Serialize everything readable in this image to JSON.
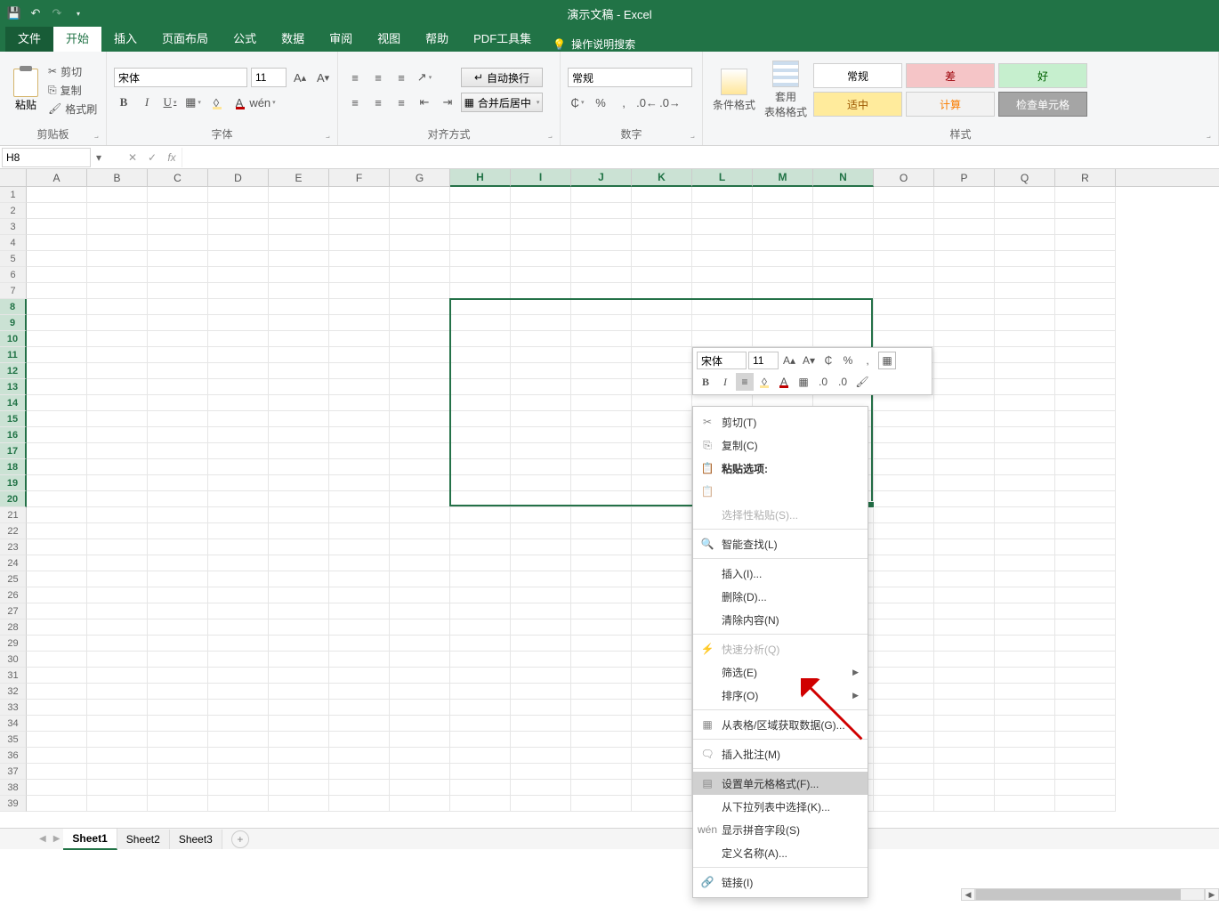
{
  "app": {
    "title": "演示文稿  -  Excel"
  },
  "tabs": {
    "file": "文件",
    "items": [
      "开始",
      "插入",
      "页面布局",
      "公式",
      "数据",
      "审阅",
      "视图",
      "帮助",
      "PDF工具集"
    ],
    "active": "开始",
    "tell": "操作说明搜索"
  },
  "ribbon": {
    "clipboard": {
      "label": "剪贴板",
      "paste": "粘贴",
      "cut": "剪切",
      "copy": "复制",
      "painter": "格式刷"
    },
    "font": {
      "label": "字体",
      "name": "宋体",
      "size": "11",
      "bold": "B",
      "italic": "I",
      "underline": "U"
    },
    "align": {
      "label": "对齐方式",
      "wrap": "自动换行",
      "merge": "合并后居中"
    },
    "number": {
      "label": "数字",
      "format": "常规",
      "percent": "%",
      "comma": ","
    },
    "styles": {
      "label": "样式",
      "cond": "条件格式",
      "table": "套用\n表格格式",
      "normal": "常规",
      "bad": "差",
      "good": "好",
      "neutral": "适中",
      "calc": "计算",
      "check": "检查单元格"
    }
  },
  "fx": {
    "cellref": "H8",
    "x": "✕",
    "chk": "✓",
    "fx": "fx"
  },
  "sheet": {
    "cols": [
      "A",
      "B",
      "C",
      "D",
      "E",
      "F",
      "G",
      "H",
      "I",
      "J",
      "K",
      "L",
      "M",
      "N",
      "O",
      "P",
      "Q",
      "R"
    ],
    "rows": 39,
    "selColsFrom": 7,
    "selColsTo": 13,
    "selRowsFrom": 8,
    "selRowsTo": 20,
    "tabs": [
      "Sheet1",
      "Sheet2",
      "Sheet3"
    ],
    "activeTab": "Sheet1"
  },
  "mini": {
    "font": "宋体",
    "size": "11"
  },
  "ctx": {
    "cut": "剪切(T)",
    "copy": "复制(C)",
    "pasteopt": "粘贴选项:",
    "pastespecial": "选择性粘贴(S)...",
    "smartlookup": "智能查找(L)",
    "insert": "插入(I)...",
    "delete": "删除(D)...",
    "clear": "清除内容(N)",
    "quick": "快速分析(Q)",
    "filter": "筛选(E)",
    "sort": "排序(O)",
    "fromtable": "从表格/区域获取数据(G)...",
    "comment": "插入批注(M)",
    "format": "设置单元格格式(F)...",
    "dropdown": "从下拉列表中选择(K)...",
    "phonetic": "显示拼音字段(S)",
    "name": "定义名称(A)...",
    "link": "链接(I)"
  }
}
